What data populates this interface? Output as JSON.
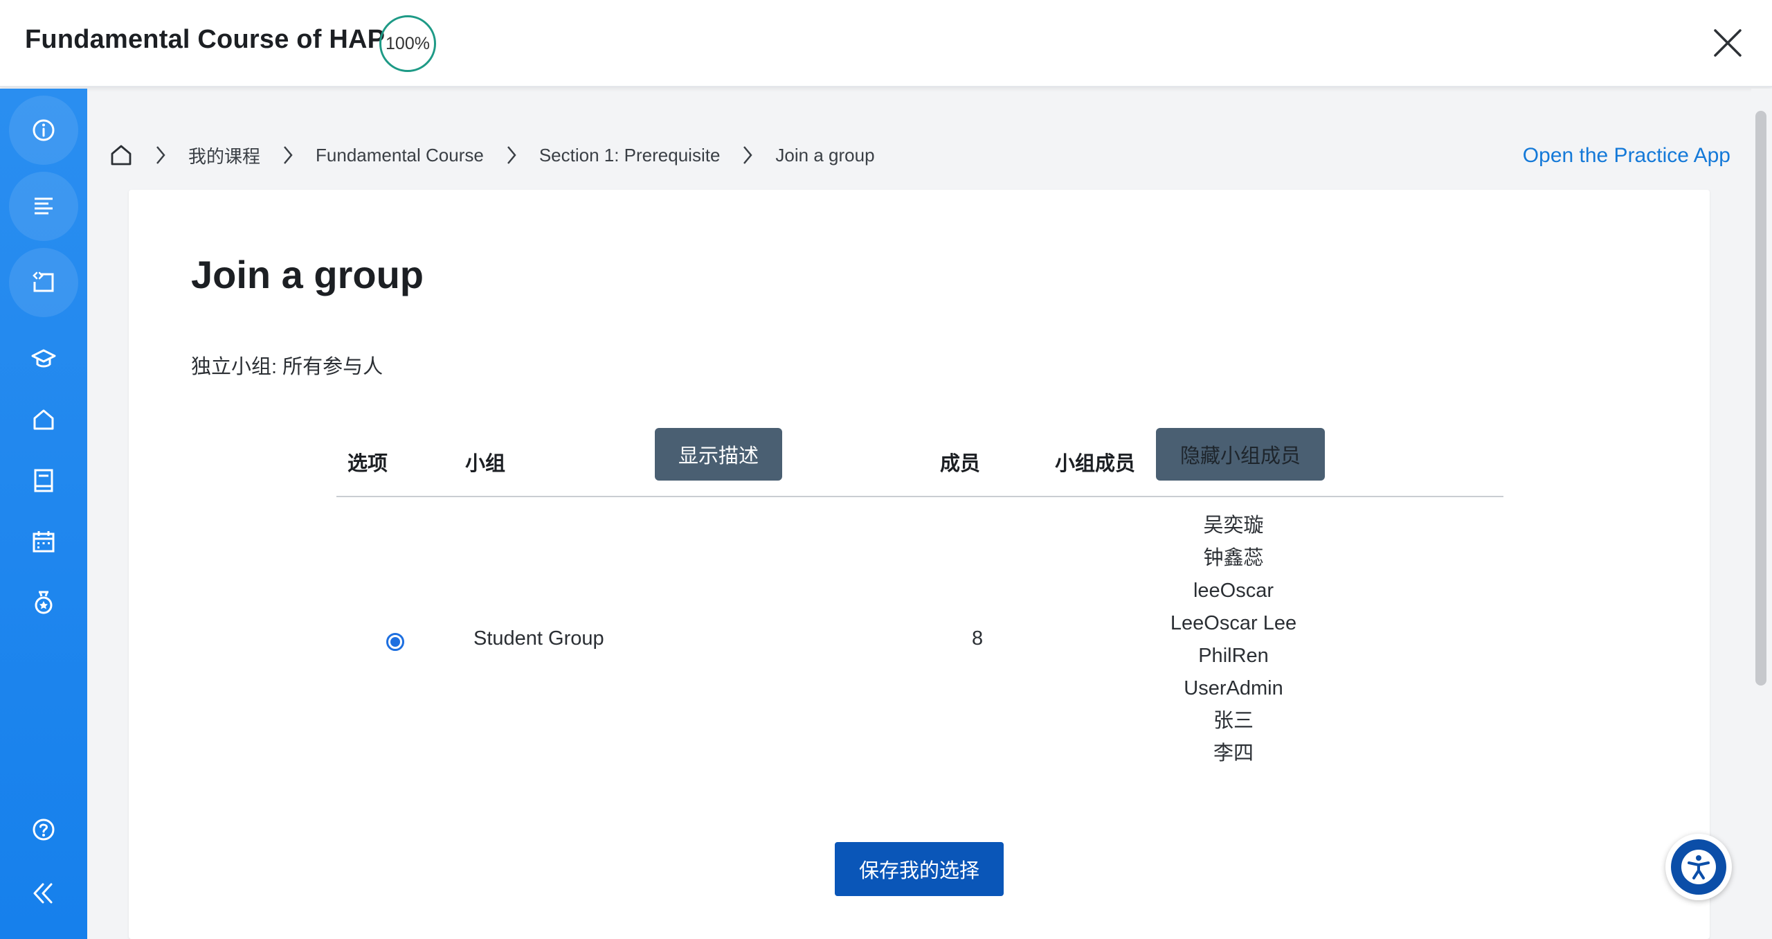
{
  "header": {
    "course_title": "Fundamental Course of HAP",
    "progress": "100%",
    "close_icon": "close-icon"
  },
  "sidebar": {
    "items": [
      {
        "icon": "info-icon"
      },
      {
        "icon": "list-icon"
      },
      {
        "icon": "code-window-icon"
      },
      {
        "icon": "graduation-cap-icon"
      },
      {
        "icon": "home-icon"
      },
      {
        "icon": "book-icon"
      },
      {
        "icon": "calendar-icon"
      },
      {
        "icon": "medal-icon"
      },
      {
        "icon": "help-icon"
      },
      {
        "icon": "collapse-icon"
      }
    ]
  },
  "breadcrumb": {
    "items": [
      "我的课程",
      "Fundamental Course",
      "Section 1: Prerequisite",
      "Join a group"
    ]
  },
  "practice_link": "Open the Practice App",
  "main": {
    "title": "Join a group",
    "group_mode": "独立小组: 所有参与人",
    "table": {
      "headers": {
        "choice": "选项",
        "group": "小组",
        "members_count": "成员",
        "group_members": "小组成员"
      },
      "show_description_button": "显示描述",
      "hide_members_button": "隐藏小组成员",
      "rows": [
        {
          "selected": true,
          "group": "Student Group",
          "count": "8",
          "members": [
            "吴奕璇",
            "钟鑫蕊",
            "leeOscar",
            "LeeOscar Lee",
            "PhilRen",
            "UserAdmin",
            "张三",
            "李四"
          ]
        }
      ]
    },
    "save_button": "保存我的选择"
  },
  "colors": {
    "rail": "#1680ec",
    "progress_ring": "#1e9a86",
    "link": "#1479d8",
    "dark_button": "#4a5f72",
    "primary_button": "#0a56b8"
  }
}
